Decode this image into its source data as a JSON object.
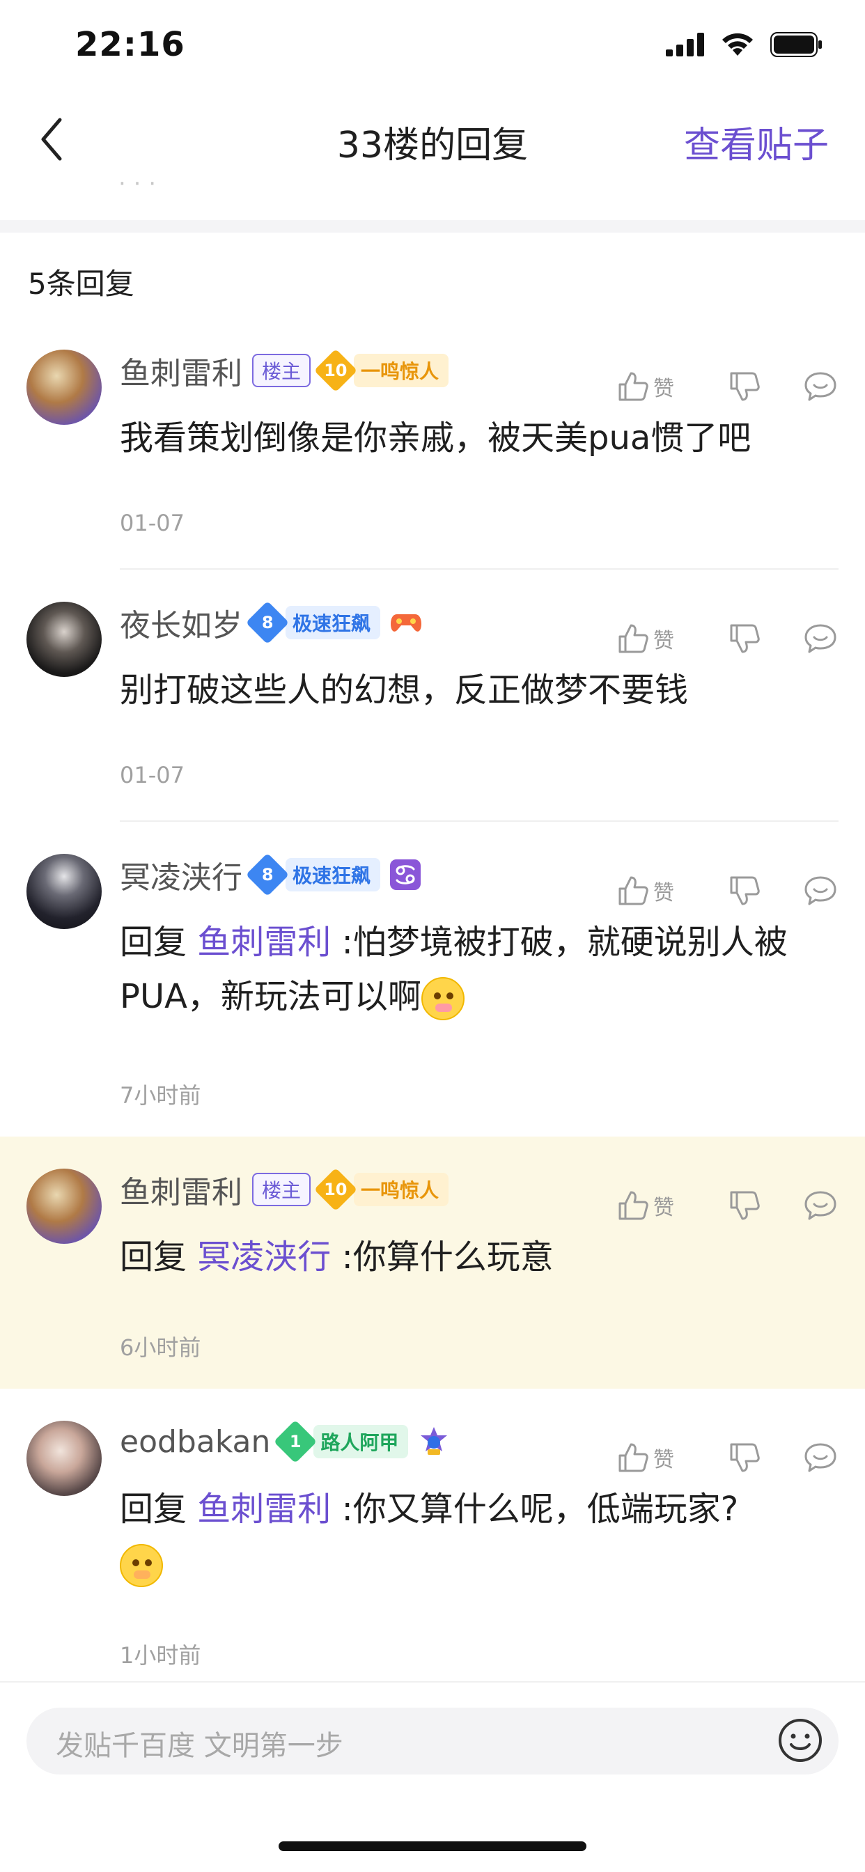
{
  "status_bar": {
    "time": "22:16"
  },
  "nav": {
    "title": "33楼的回复",
    "action": "查看贴子"
  },
  "reply_count": "5条回复",
  "like_label": "赞",
  "input_placeholder": "发贴千百度 文明第一步",
  "comments": [
    {
      "username": "鱼刺雷利",
      "owner_badge": "楼主",
      "level": "10",
      "level_title": "一鸣惊人",
      "text": "我看策划倒像是你亲戚，被天美pua惯了吧",
      "time": "01-07"
    },
    {
      "username": "夜长如岁",
      "level": "8",
      "level_title": "极速狂飙",
      "text": "别打破这些人的幻想，反正做梦不要钱",
      "time": "01-07"
    },
    {
      "username": "冥凌浃行",
      "level": "8",
      "level_title": "极速狂飙",
      "reply_prefix": "回复",
      "mention": "鱼刺雷利",
      "text": ":怕梦境被打破，就硬说别人被PUA，新玩法可以啊",
      "time": "7小时前"
    },
    {
      "username": "鱼刺雷利",
      "owner_badge": "楼主",
      "level": "10",
      "level_title": "一鸣惊人",
      "reply_prefix": "回复",
      "mention": "冥凌浃行",
      "text": ":你算什么玩意",
      "time": "6小时前"
    },
    {
      "username": "eodbakan",
      "level": "1",
      "level_title": "路人阿甲",
      "reply_prefix": "回复",
      "mention": "鱼刺雷利",
      "text": ":你又算什么呢，低端玩家?",
      "time": "1小时前"
    }
  ]
}
